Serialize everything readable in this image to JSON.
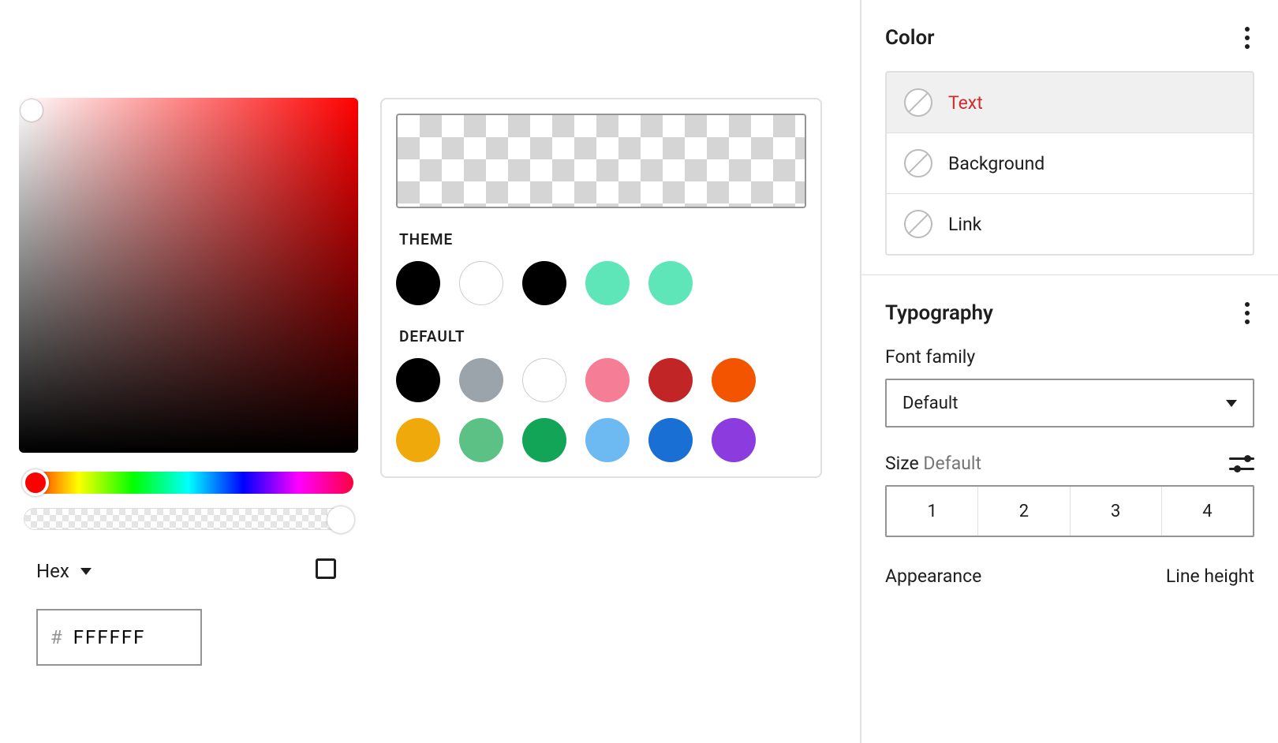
{
  "colorPicker": {
    "formatLabel": "Hex",
    "hexValue": "FFFFFF",
    "hashSymbol": "#",
    "hueColor": "#ff0000"
  },
  "swatchesPanel": {
    "themeLabel": "THEME",
    "defaultLabel": "DEFAULT",
    "themeColors": [
      "#000000",
      "#ffffff",
      "#000000",
      "#5ee6b8",
      "#5ee6b8"
    ],
    "defaultRow1": [
      "#000000",
      "#9ba4ab",
      "#ffffff",
      "#f67d96",
      "#c22525",
      "#f25400"
    ],
    "defaultRow2": [
      "#f0a90a",
      "#5cc185",
      "#12a457",
      "#6db9f2",
      "#1a6fd4",
      "#8c3cde"
    ]
  },
  "sidebar": {
    "colorSection": {
      "title": "Color",
      "items": [
        {
          "label": "Text",
          "active": true
        },
        {
          "label": "Background",
          "active": false
        },
        {
          "label": "Link",
          "active": false
        }
      ]
    },
    "typography": {
      "title": "Typography",
      "fontFamilyLabel": "Font family",
      "fontFamilyValue": "Default",
      "sizeLabel": "Size",
      "sizeValue": "Default",
      "sizeButtons": [
        "1",
        "2",
        "3",
        "4"
      ],
      "appearanceLabel": "Appearance",
      "lineHeightLabel": "Line height"
    }
  }
}
